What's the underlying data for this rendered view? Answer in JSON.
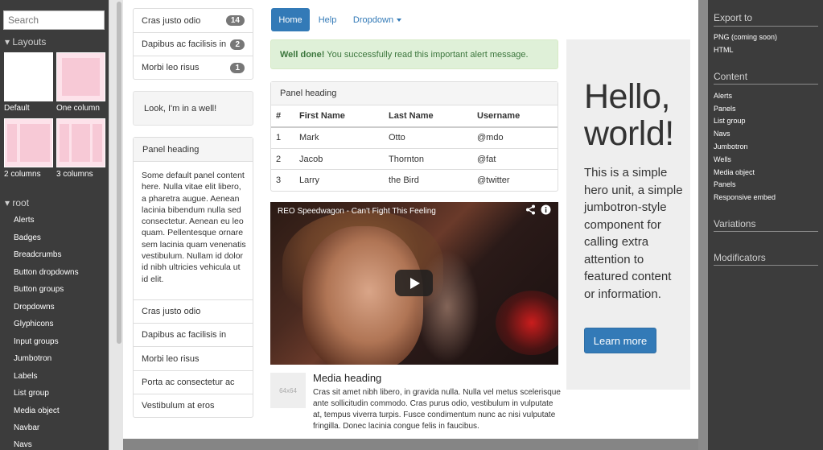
{
  "left_sidebar": {
    "search_placeholder": "Search",
    "layouts_heading": "▾ Layouts",
    "layouts": [
      "Default",
      "One column",
      "2 columns",
      "3 columns"
    ],
    "root_heading": "▾ root",
    "root_items": [
      "Alerts",
      "Badges",
      "Breadcrumbs",
      "Button dropdowns",
      "Button groups",
      "Dropdowns",
      "Glyphicons",
      "Input groups",
      "Jumbotron",
      "Labels",
      "List group",
      "Media object",
      "Navbar",
      "Navs"
    ]
  },
  "top_list": [
    {
      "label": "Cras justo odio",
      "badge": "14"
    },
    {
      "label": "Dapibus ac facilisis in",
      "badge": "2"
    },
    {
      "label": "Morbi leo risus",
      "badge": "1"
    }
  ],
  "well_text": "Look, I'm in a well!",
  "left_panel": {
    "heading": "Panel heading",
    "body": "Some default panel content here. Nulla vitae elit libero, a pharetra augue. Aenean lacinia bibendum nulla sed consectetur. Aenean eu leo quam. Pellentesque ornare sem lacinia quam venenatis vestibulum. Nullam id dolor id nibh ultricies vehicula ut id elit.",
    "items": [
      "Cras justo odio",
      "Dapibus ac facilisis in",
      "Morbi leo risus",
      "Porta ac consectetur ac",
      "Vestibulum at eros"
    ]
  },
  "nav": {
    "home": "Home",
    "help": "Help",
    "dropdown": "Dropdown"
  },
  "alert": {
    "strong": "Well done!",
    "text": " You successfully read this important alert message."
  },
  "table_panel": {
    "heading": "Panel heading",
    "columns": [
      "#",
      "First Name",
      "Last Name",
      "Username"
    ],
    "rows": [
      [
        "1",
        "Mark",
        "Otto",
        "@mdo"
      ],
      [
        "2",
        "Jacob",
        "Thornton",
        "@fat"
      ],
      [
        "3",
        "Larry",
        "the Bird",
        "@twitter"
      ]
    ]
  },
  "video": {
    "title": "REO Speedwagon - Can't Fight This Feeling"
  },
  "media": {
    "thumb_label": "64x64",
    "heading": "Media heading",
    "body": "Cras sit amet nibh libero, in gravida nulla. Nulla vel metus scelerisque ante sollicitudin commodo. Cras purus odio, vestibulum in vulputate at, tempus viverra turpis. Fusce condimentum nunc ac nisi vulputate fringilla. Donec lacinia congue felis in faucibus."
  },
  "jumbotron": {
    "title": "Hello, world!",
    "text": "This is a simple hero unit, a simple jumbotron-style component for calling extra attention to featured content or information.",
    "button": "Learn more"
  },
  "right_sidebar": {
    "export_heading": "Export to",
    "export_items": [
      "PNG (coming soon)",
      "HTML"
    ],
    "content_heading": "Content",
    "content_items": [
      "Alerts",
      "Panels",
      "List group",
      "Navs",
      "Jumbotron",
      "Wells",
      "Media object",
      "Panels",
      "Responsive embed"
    ],
    "variations_heading": "Variations",
    "modificators_heading": "Modificators"
  },
  "colors": {
    "primary": "#337ab7",
    "sidebar": "#3c3c3c",
    "alert_bg": "#dff0d8",
    "alert_text": "#3c763d"
  }
}
